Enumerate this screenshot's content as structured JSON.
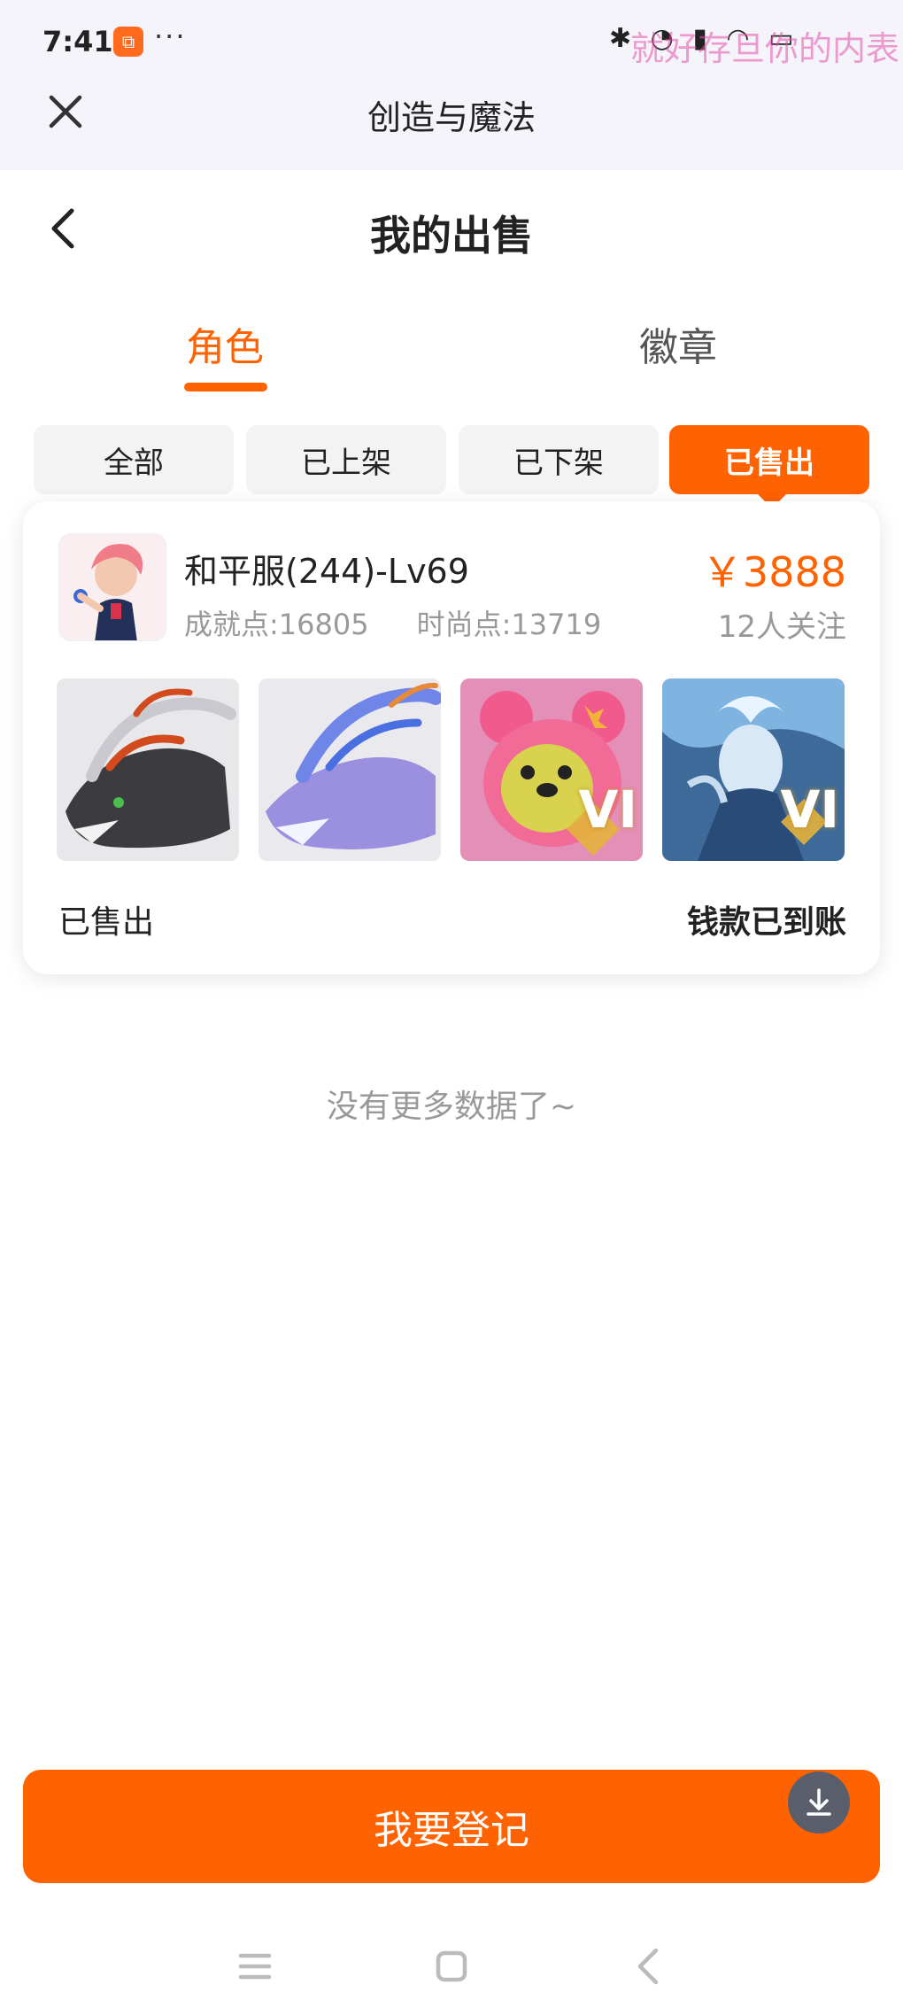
{
  "status_bar": {
    "time": "7:41",
    "more": "···",
    "icons": "✱ ◔ ▮ ◠ ▭",
    "watermark": "就好存旦你的内表"
  },
  "header": {
    "app_title": "创造与魔法"
  },
  "page": {
    "title": "我的出售"
  },
  "tabs": [
    {
      "label": "角色",
      "active": true
    },
    {
      "label": "徽章",
      "active": false
    }
  ],
  "filters": [
    {
      "label": "全部",
      "active": false
    },
    {
      "label": "已上架",
      "active": false
    },
    {
      "label": "已下架",
      "active": false
    },
    {
      "label": "已售出",
      "active": true
    }
  ],
  "listing": {
    "name": "和平服(244)-Lv69",
    "achievement": "成就点:16805",
    "fashion": "时尚点:13719",
    "price": "￥3888",
    "followers": "12人关注",
    "thumbs": [
      {
        "icon": "black-dragon-thumb",
        "badge": ""
      },
      {
        "icon": "blue-dragon-thumb",
        "badge": ""
      },
      {
        "icon": "pink-bear-thumb",
        "badge": "VI"
      },
      {
        "icon": "ice-warrior-thumb",
        "badge": "VI"
      }
    ],
    "status": "已售出",
    "payment_status": "钱款已到账"
  },
  "empty_hint": "没有更多数据了~",
  "register_button": "我要登记",
  "colors": {
    "accent": "#ff6200",
    "topbar_bg": "#f4f4fa",
    "muted_text": "#999999"
  }
}
